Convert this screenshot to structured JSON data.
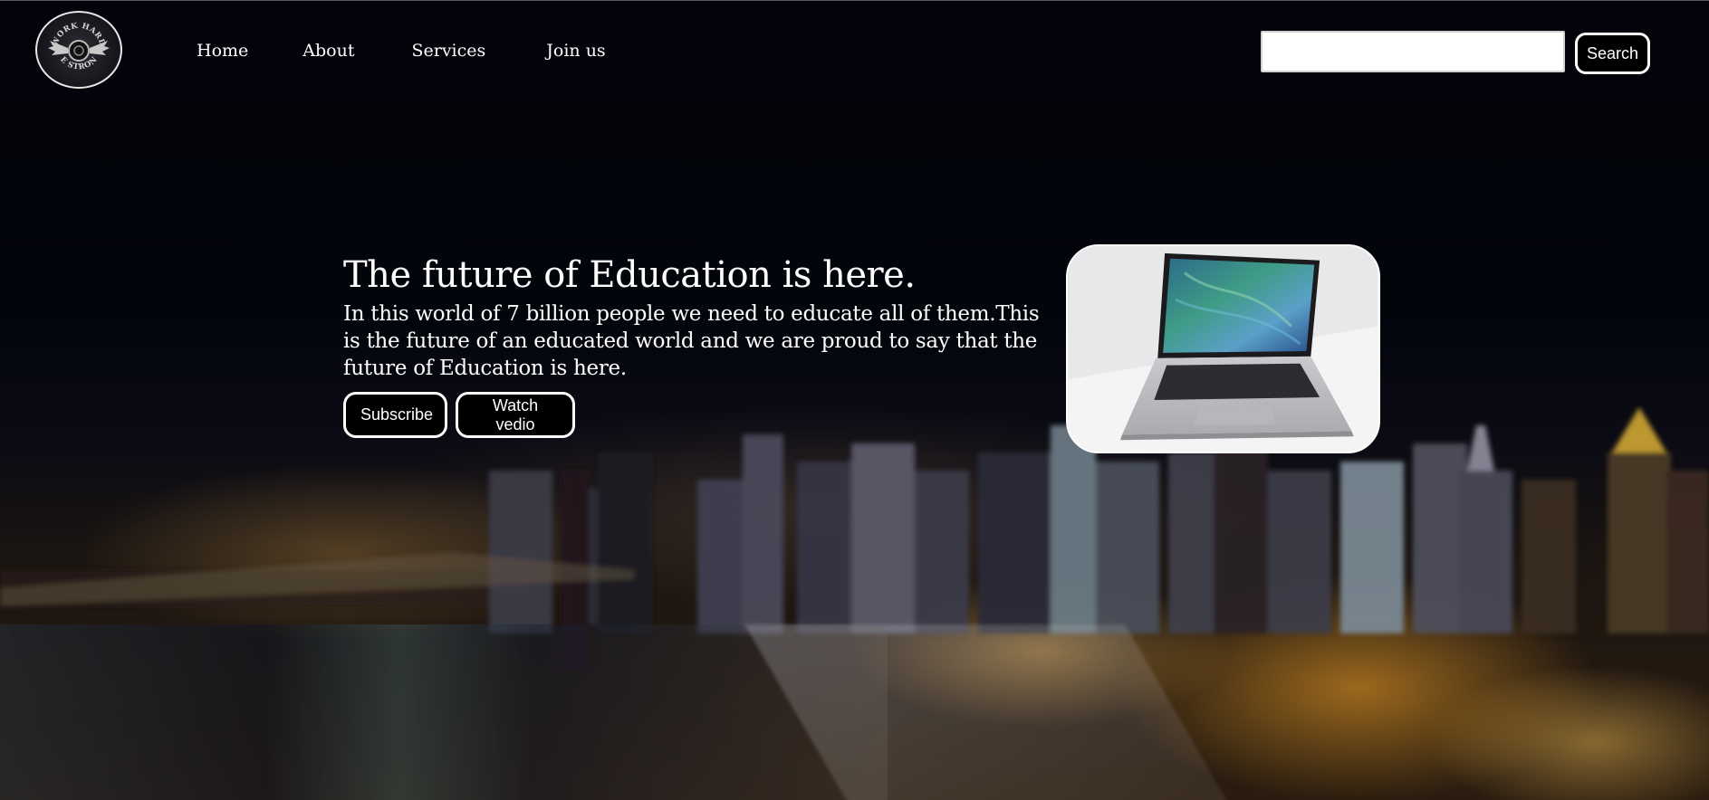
{
  "header": {
    "logo": {
      "text_top": "WORK HARD",
      "text_bottom": "BE STRONG"
    },
    "nav": [
      {
        "label": "Home"
      },
      {
        "label": "About"
      },
      {
        "label": "Services"
      },
      {
        "label": "Join us"
      }
    ],
    "search": {
      "value": "",
      "placeholder": "",
      "button_label": "Search"
    }
  },
  "hero": {
    "title": "The future of Education is here.",
    "text": "In this world of 7 billion people we need to educate all of them.This is the future of an educated world and we are proud to say that the future of Education is here.",
    "buttons": {
      "subscribe": "Subscribe",
      "watch": "Watch vedio"
    },
    "image_icon": "laptop-image"
  },
  "colors": {
    "header_bg": "#03050c",
    "button_bg": "#000000",
    "button_border": "#ffffff",
    "text": "#ffffff"
  }
}
